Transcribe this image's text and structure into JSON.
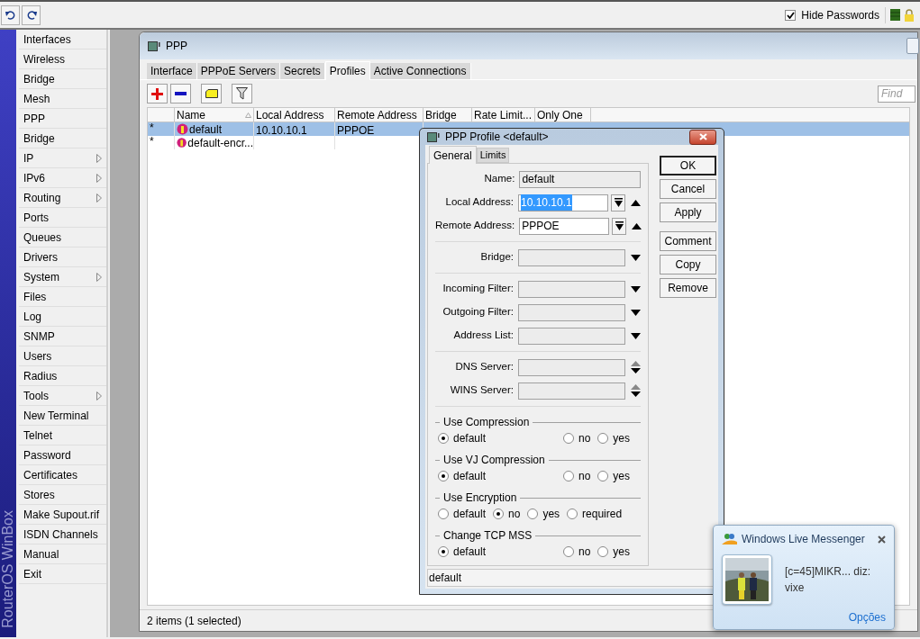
{
  "toolbar": {
    "hide_passwords": {
      "label": "Hide Passwords",
      "checked": true
    }
  },
  "sidebar": {
    "brand": "RouterOS WinBox",
    "items": [
      {
        "label": "Interfaces",
        "submenu": false
      },
      {
        "label": "Wireless",
        "submenu": false
      },
      {
        "label": "Bridge",
        "submenu": false
      },
      {
        "label": "Mesh",
        "submenu": false
      },
      {
        "label": "PPP",
        "submenu": false
      },
      {
        "label": "Bridge",
        "submenu": false
      },
      {
        "label": "IP",
        "submenu": true
      },
      {
        "label": "IPv6",
        "submenu": true
      },
      {
        "label": "Routing",
        "submenu": true
      },
      {
        "label": "Ports",
        "submenu": false
      },
      {
        "label": "Queues",
        "submenu": false
      },
      {
        "label": "Drivers",
        "submenu": false
      },
      {
        "label": "System",
        "submenu": true
      },
      {
        "label": "Files",
        "submenu": false
      },
      {
        "label": "Log",
        "submenu": false
      },
      {
        "label": "SNMP",
        "submenu": false
      },
      {
        "label": "Users",
        "submenu": false
      },
      {
        "label": "Radius",
        "submenu": false
      },
      {
        "label": "Tools",
        "submenu": true
      },
      {
        "label": "New Terminal",
        "submenu": false
      },
      {
        "label": "Telnet",
        "submenu": false
      },
      {
        "label": "Password",
        "submenu": false
      },
      {
        "label": "Certificates",
        "submenu": false
      },
      {
        "label": "Stores",
        "submenu": false
      },
      {
        "label": "Make Supout.rif",
        "submenu": false
      },
      {
        "label": "ISDN Channels",
        "submenu": false
      },
      {
        "label": "Manual",
        "submenu": false
      },
      {
        "label": "Exit",
        "submenu": false
      }
    ]
  },
  "ppp_window": {
    "title": "PPP",
    "tabs": [
      {
        "label": "Interface",
        "selected": false
      },
      {
        "label": "PPPoE Servers",
        "selected": false
      },
      {
        "label": "Secrets",
        "selected": false
      },
      {
        "label": "Profiles",
        "selected": true
      },
      {
        "label": "Active Connections",
        "selected": false
      }
    ],
    "find": {
      "placeholder": "Find"
    },
    "table": {
      "columns": [
        "Name",
        "Local Address",
        "Remote Address",
        "Bridge",
        "Rate Limit...",
        "Only One"
      ],
      "rows": [
        {
          "flag": "*",
          "name": "default",
          "local_address": "10.10.10.1",
          "remote_address": "PPPOE",
          "selected": true
        },
        {
          "flag": "*",
          "name": "default-encr...",
          "local_address": "",
          "remote_address": "",
          "selected": false
        }
      ]
    },
    "status": "2 items (1 selected)"
  },
  "profile_dialog": {
    "title": "PPP Profile <default>",
    "tabs": [
      {
        "label": "General",
        "selected": true
      },
      {
        "label": "Limits",
        "selected": false
      }
    ],
    "field_groups": [
      [
        {
          "kind": "text",
          "label": "Name:",
          "value": "default"
        },
        {
          "kind": "combo",
          "label": "Local Address:",
          "value": "10.10.10.1",
          "value_selected": true
        },
        {
          "kind": "combo",
          "label": "Remote Address:",
          "value": "PPPOE",
          "value_selected": false
        }
      ],
      [
        {
          "kind": "dropdown",
          "label": "Bridge:"
        }
      ],
      [
        {
          "kind": "dropdown",
          "label": "Incoming Filter:"
        },
        {
          "kind": "dropdown",
          "label": "Outgoing Filter:"
        },
        {
          "kind": "dropdown",
          "label": "Address List:"
        }
      ],
      [
        {
          "kind": "updown",
          "label": "DNS Server:"
        },
        {
          "kind": "updown",
          "label": "WINS Server:"
        }
      ]
    ],
    "radio_groups": [
      {
        "title": "Use Compression",
        "options": [
          {
            "label": "default",
            "selected": true
          },
          {
            "label": "no",
            "selected": false
          },
          {
            "label": "yes",
            "selected": false
          }
        ]
      },
      {
        "title": "Use VJ Compression",
        "options": [
          {
            "label": "default",
            "selected": true
          },
          {
            "label": "no",
            "selected": false
          },
          {
            "label": "yes",
            "selected": false
          }
        ]
      },
      {
        "title": "Use Encryption",
        "options": [
          {
            "label": "default",
            "selected": false
          },
          {
            "label": "no",
            "selected": true
          },
          {
            "label": "yes",
            "selected": false
          },
          {
            "label": "required",
            "selected": false
          }
        ]
      },
      {
        "title": "Change TCP MSS",
        "options": [
          {
            "label": "default",
            "selected": true
          },
          {
            "label": "no",
            "selected": false
          },
          {
            "label": "yes",
            "selected": false
          }
        ]
      }
    ],
    "button_groups": [
      [
        {
          "label": "OK",
          "default": true
        },
        {
          "label": "Cancel",
          "default": false
        },
        {
          "label": "Apply",
          "default": false
        }
      ],
      [
        {
          "label": "Comment",
          "default": false
        },
        {
          "label": "Copy",
          "default": false
        },
        {
          "label": "Remove",
          "default": false
        }
      ]
    ],
    "status": "default"
  },
  "notification": {
    "title": "Windows Live Messenger",
    "message": "[c=45]MIKR... diz:",
    "body": "vixe",
    "link": "Opções"
  }
}
